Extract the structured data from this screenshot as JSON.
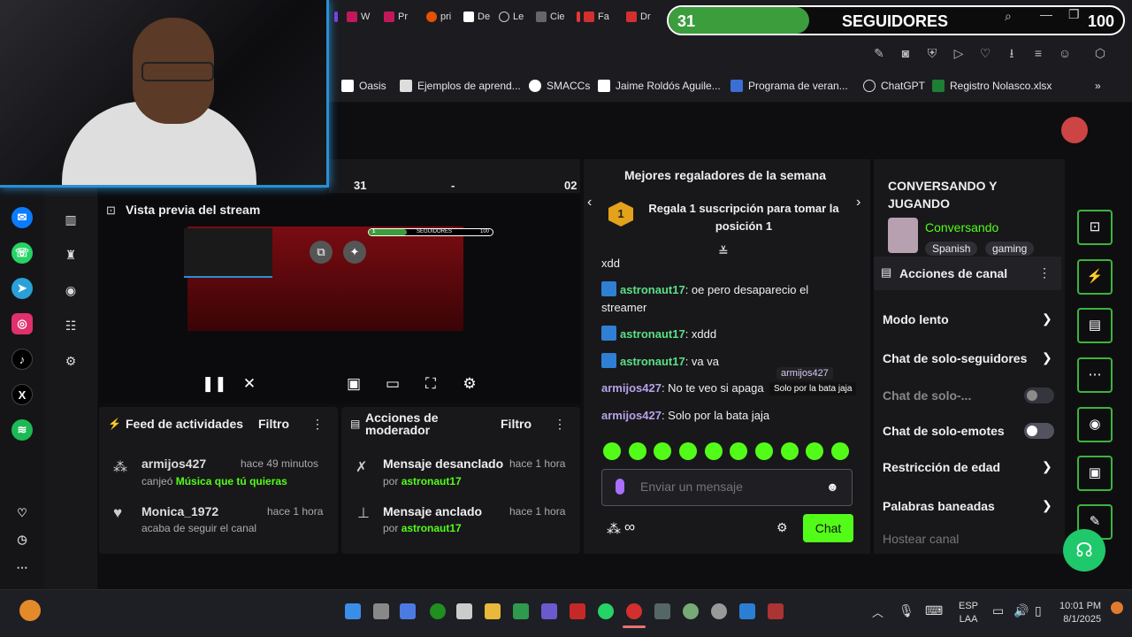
{
  "browser": {
    "tabs": [
      "W",
      "Pr",
      "pri",
      "De",
      "Le",
      "Cie",
      "Fa",
      "Dr"
    ],
    "bookmarks": [
      "Oasis",
      "Ejemplos de aprend...",
      "SMACCs",
      "Jaime Roldós Aguile...",
      "Programa de veran...",
      "ChatGPT",
      "Registro Nolasco.xlsx"
    ],
    "overflow": "»"
  },
  "follower_goal": {
    "current": "31",
    "label": "SEGUIDORES",
    "target": "100",
    "progress": 0.31
  },
  "stats_row": {
    "a": "31",
    "b": "-",
    "c": "02"
  },
  "stream_preview": {
    "title": "Vista previa del stream",
    "mini_current": "1",
    "mini_label": "SEGUIDORES",
    "mini_target": "100"
  },
  "feed": {
    "title": "Feed de actividades",
    "filter": "Filtro",
    "items": [
      {
        "user": "armijos427",
        "time": "hace 49 minutos",
        "text": "canjeó",
        "reward": "Música que tú quieras"
      },
      {
        "user": "Monica_1972",
        "time": "hace 1 hora",
        "text": "acaba de seguir el canal"
      }
    ]
  },
  "mod": {
    "title": "Acciones de moderador",
    "filter": "Filtro",
    "items": [
      {
        "action": "Mensaje desanclado",
        "time": "hace 1 hora",
        "by": "por",
        "user": "astronaut17"
      },
      {
        "action": "Mensaje anclado",
        "time": "hace 1 hora",
        "by": "por",
        "user": "astronaut17"
      }
    ]
  },
  "chat": {
    "gifters_title": "Mejores regaladores de la semana",
    "gift_text": "Regala 1 suscripción para tomar la posición 1",
    "rank": "1",
    "messages": [
      {
        "user": "",
        "text": "xdd"
      },
      {
        "user": "astronaut17",
        "text": ": oe pero desaparecio el streamer"
      },
      {
        "user": "astronaut17",
        "text": ": xddd"
      },
      {
        "user": "astronaut17",
        "text": ": va va"
      },
      {
        "user": "armijos427",
        "text": ": No te veo si apaga"
      },
      {
        "user": "armijos427",
        "text": ": Solo por la bata jaja"
      }
    ],
    "tooltip_user": "armijos427",
    "tooltip_text": "Solo por la bata jaja",
    "input_placeholder": "Enviar un mensaje",
    "points": "∞",
    "send": "Chat"
  },
  "channel": {
    "title": "CONVERSANDO Y JUGANDO",
    "category": "Conversando",
    "tags": [
      "Spanish",
      "gaming"
    ],
    "actions_title": "Acciones de canal",
    "actions": [
      {
        "label": "Modo lento",
        "type": "chevron"
      },
      {
        "label": "Chat de solo-seguidores",
        "type": "chevron"
      },
      {
        "label": "Chat de solo-...",
        "type": "toggle"
      },
      {
        "label": "Chat de solo-emotes",
        "type": "toggle"
      },
      {
        "label": "Restricción de edad",
        "type": "chevron"
      },
      {
        "label": "Palabras baneadas",
        "type": "chevron"
      },
      {
        "label": "Hostear canal",
        "type": "none"
      }
    ]
  },
  "taskbar": {
    "lang": "ESP",
    "layout": "LAA",
    "time": "10:01 PM",
    "date": "8/1/2025"
  }
}
